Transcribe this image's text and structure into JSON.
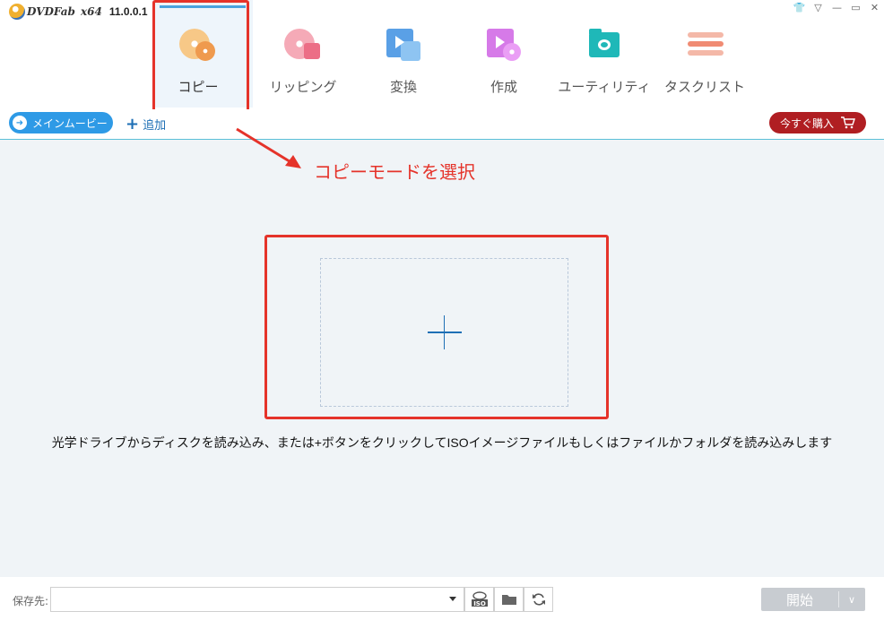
{
  "app": {
    "logo_text": "DVDFab",
    "arch": "x64",
    "version": "11.0.0.1"
  },
  "window_controls": [
    "shirt-icon",
    "menu-icon",
    "minimize-icon",
    "maximize-icon",
    "close-icon"
  ],
  "nav": {
    "items": [
      {
        "label": "コピー",
        "icon": "copy-disc-icon",
        "active": true
      },
      {
        "label": "リッピング",
        "icon": "ripper-icon",
        "active": false
      },
      {
        "label": "変換",
        "icon": "converter-icon",
        "active": false
      },
      {
        "label": "作成",
        "icon": "creator-icon",
        "active": false
      },
      {
        "label": "ユーティリティ",
        "icon": "utilities-icon",
        "active": false
      },
      {
        "label": "タスクリスト",
        "icon": "task-list-icon",
        "active": false
      }
    ]
  },
  "toolbar": {
    "mode_label": "メインムービー",
    "add_label": "追加",
    "buy_label": "今すぐ購入"
  },
  "annotation": {
    "text": "コピーモードを選択",
    "color": "#e5332a"
  },
  "main": {
    "hint": "光学ドライブからディスクを読み込み、または+ボタンをクリックしてISOイメージファイルもしくはファイルかフォルダを読み込みします"
  },
  "bottom": {
    "save_label": "保存先:",
    "save_value": "",
    "start_label": "開始"
  },
  "colors": {
    "accent_blue": "#2e9ae6",
    "buy_red": "#b01e22",
    "highlight_red": "#e5332a",
    "main_bg": "#f0f4f7"
  }
}
